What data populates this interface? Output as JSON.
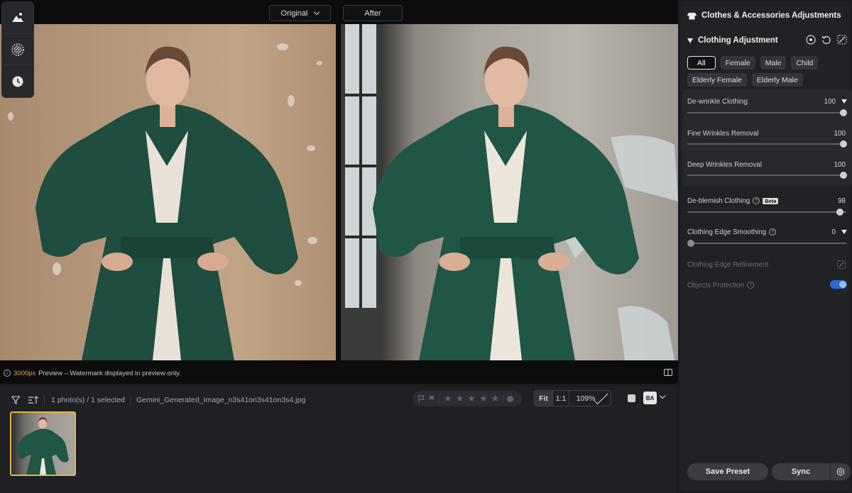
{
  "viewer": {
    "original_label": "Original",
    "after_label": "After",
    "preview_size": "3000px",
    "preview_note": "Preview – Watermark displayed in preview only."
  },
  "toolbar": {
    "icons": [
      "landscape-icon",
      "texture-icon",
      "history-icon"
    ]
  },
  "filmstrip": {
    "selection": "1 photo(s) / 1 selected",
    "filename": "Gemini_Generated_Image_n3s41on3s41on3s4.jpg",
    "zoom_fit": "Fit",
    "zoom_one": "1:1",
    "zoom_level": "109%",
    "ba_label": "BA",
    "rating": 0
  },
  "panel": {
    "title": "Clothes & Accessories Adjustments",
    "section_title": "Clothing Adjustment",
    "chips": [
      "All",
      "Female",
      "Male",
      "Child",
      "Elderly Female",
      "Elderly Male"
    ],
    "active_chip": "All",
    "dewrinkle": {
      "label": "De-wrinkle Clothing",
      "value": "100"
    },
    "fine": {
      "label": "Fine Wrinkles Removal",
      "value": "100"
    },
    "deep": {
      "label": "Deep Wrinkles Removal",
      "value": "100"
    },
    "deblemish": {
      "label": "De-blemish Clothing",
      "badge": "Beta",
      "value": "98"
    },
    "edge_smoothing": {
      "label": "Clothing Edge Smoothing",
      "value": "0"
    },
    "edge_refinement": {
      "label": "Clothing Edge Refinement"
    },
    "objects_protection": {
      "label": "Objects Protection",
      "enabled": true
    },
    "save_preset": "Save Preset",
    "sync": "Sync"
  },
  "colors": {
    "accent": "#e2b64a",
    "coat": "#1f4d3f",
    "toggle": "#2d6ad1"
  }
}
